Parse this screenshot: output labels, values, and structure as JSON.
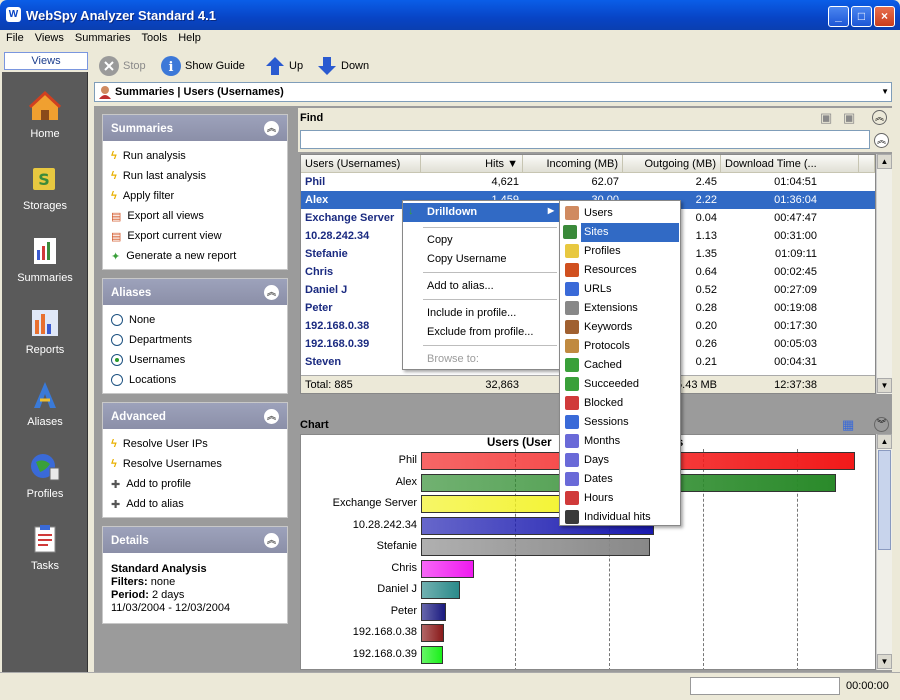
{
  "window": {
    "title": "WebSpy Analyzer Standard 4.1",
    "minimize": "_",
    "maximize": "□",
    "close": "×"
  },
  "menu": [
    "File",
    "Views",
    "Summaries",
    "Tools",
    "Help"
  ],
  "toolbar": {
    "views": "Views",
    "stop": "Stop",
    "show_guide": "Show Guide",
    "up": "Up",
    "down": "Down"
  },
  "nav": [
    "Home",
    "Storages",
    "Summaries",
    "Reports",
    "Aliases",
    "Profiles",
    "Tasks"
  ],
  "address": "Summaries | Users (Usernames)",
  "summaries": {
    "title": "Summaries",
    "items": [
      "Run analysis",
      "Run last analysis",
      "Apply filter",
      "Export all views",
      "Export current view",
      "Generate a new report"
    ]
  },
  "aliases": {
    "title": "Aliases",
    "items": [
      "None",
      "Departments",
      "Usernames",
      "Locations"
    ],
    "selected": "Usernames"
  },
  "advanced": {
    "title": "Advanced",
    "items": [
      "Resolve User IPs",
      "Resolve Usernames",
      "Add to profile",
      "Add to alias"
    ]
  },
  "details": {
    "title": "Details",
    "name": "Standard Analysis",
    "filters_label": "Filters:",
    "filters_value": "none",
    "period_label": "Period:",
    "period_value": "2 days",
    "range": "11/03/2004 - 12/03/2004"
  },
  "find": {
    "label": "Find"
  },
  "table": {
    "columns": [
      "Users (Usernames)",
      "Hits",
      "Incoming (MB)",
      "Outgoing (MB)",
      "Download Time (..."
    ],
    "rows": [
      [
        "Phil",
        "4,621",
        "62.07",
        "2.45",
        "01:04:51"
      ],
      [
        "Alex",
        "1,459",
        "30.00",
        "2.22",
        "01:36:04"
      ],
      [
        "Exchange Server",
        "",
        "",
        "0.04",
        "00:47:47"
      ],
      [
        "10.28.242.34",
        "",
        "",
        "1.13",
        "00:31:00"
      ],
      [
        "Stefanie",
        "",
        "",
        "1.35",
        "01:09:11"
      ],
      [
        "Chris",
        "",
        "",
        "0.64",
        "00:02:45"
      ],
      [
        "Daniel J",
        "",
        "",
        "0.52",
        "00:27:09"
      ],
      [
        "Peter",
        "",
        "",
        "0.28",
        "00:19:08"
      ],
      [
        "192.168.0.38",
        "",
        "",
        "0.20",
        "00:17:30"
      ],
      [
        "192.168.0.39",
        "",
        "",
        "0.26",
        "00:05:03"
      ],
      [
        "Steven",
        "",
        "",
        "0.21",
        "00:04:31"
      ]
    ],
    "total": [
      "Total: 885",
      "32,863",
      "",
      "5.43 MB",
      "12:37:38"
    ]
  },
  "context_menu": {
    "drilldown": "Drilldown",
    "copy": "Copy",
    "copy_username": "Copy Username",
    "add_alias": "Add to alias...",
    "include_profile": "Include in profile...",
    "exclude_profile": "Exclude from profile...",
    "browse": "Browse to:"
  },
  "submenu": [
    "Users",
    "Sites",
    "Profiles",
    "Resources",
    "URLs",
    "Extensions",
    "Keywords",
    "Protocols",
    "Cached",
    "Succeeded",
    "Blocked",
    "Sessions",
    "Months",
    "Days",
    "Dates",
    "Hours",
    "Individual hits"
  ],
  "chart_label": "Chart",
  "chart_data": {
    "type": "bar",
    "orientation": "horizontal",
    "title": "Users (Usernames) - Hits",
    "title_visible_fragments": [
      "Users (User",
      "ts"
    ],
    "categories": [
      "Phil",
      "Alex",
      "Exchange Server",
      "10.28.242.34",
      "Stefanie",
      "Chris",
      "Daniel J",
      "Peter",
      "192.168.0.38",
      "192.168.0.39"
    ],
    "values": [
      4621,
      4420,
      2400,
      2480,
      2440,
      560,
      420,
      270,
      240,
      230
    ],
    "xlim": [
      0,
      5000
    ],
    "grid": true,
    "colors": [
      "#f21a1a",
      "#2a8a2a",
      "#f2f21a",
      "#1a1ab0",
      "#888888",
      "#f01af0",
      "#2a8a8a",
      "#1a1a80",
      "#8a1a1a",
      "#1af01a"
    ]
  },
  "status": {
    "time": "00:00:00"
  }
}
